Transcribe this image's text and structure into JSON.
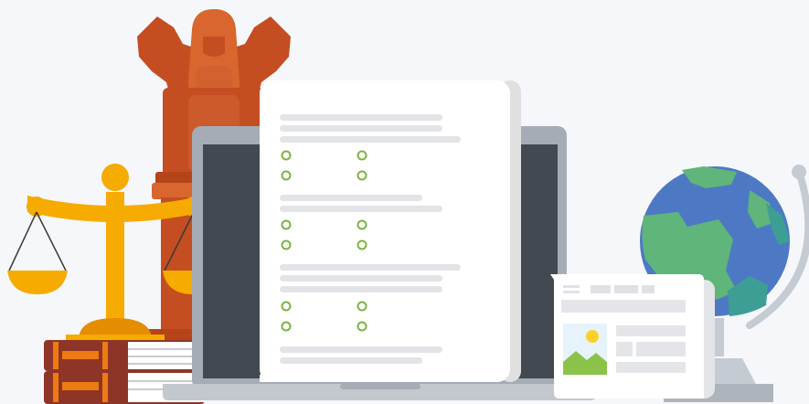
{
  "illustration": {
    "palette": {
      "background": "#f6f7fb",
      "emblem": "#c44e21",
      "emblem_light": "#d8662e",
      "scales": "#f6ab00",
      "scales_dark": "#e48d00",
      "books": "#8f3527",
      "books_accent": "#ee7a14",
      "laptop_frame": "#a5acb5",
      "laptop_screen": "#434951",
      "paper": "#ffffff",
      "form_line": "#e3e4e7",
      "radio_green": "#7cb342",
      "globe_ocean": "#4d79c4",
      "globe_land": "#5fb57a",
      "globe_teal": "#3d9e94",
      "newspaper_line": "#dfe1e4"
    },
    "form": {
      "question_groups": 3,
      "options_per_group": 4
    },
    "icons": [
      "ashoka-emblem-icon",
      "scales-of-justice-icon",
      "law-books-icon",
      "laptop-icon",
      "form-document-icon",
      "radio-option-icon",
      "newspaper-icon",
      "image-placeholder-icon",
      "globe-icon"
    ]
  }
}
